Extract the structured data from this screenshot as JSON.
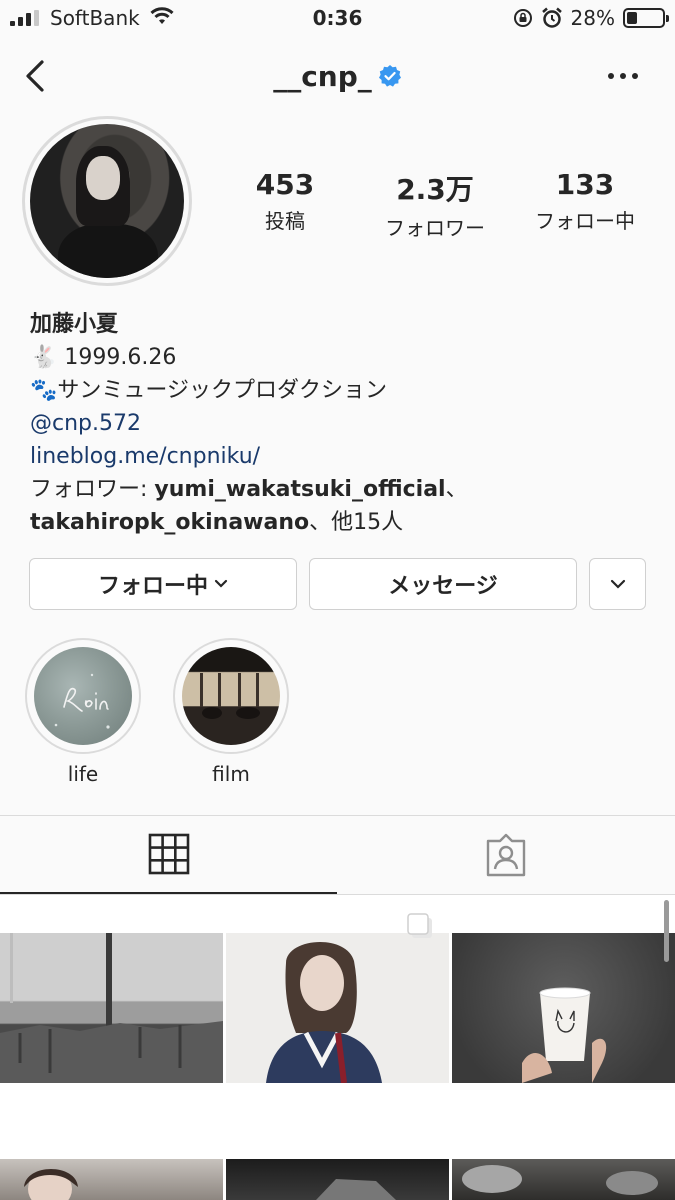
{
  "status_bar": {
    "carrier": "SoftBank",
    "time": "0:36",
    "battery": "28%",
    "battery_level": 0.28,
    "icons": [
      "signal-icon",
      "wifi-icon",
      "orientation-lock-icon",
      "alarm-icon",
      "battery-icon"
    ]
  },
  "header": {
    "username": "__cnp_",
    "verified": true,
    "icons": [
      "back-chevron-icon",
      "verified-badge-icon",
      "more-dots-icon"
    ]
  },
  "stats": [
    {
      "value": "453",
      "label": "投稿"
    },
    {
      "value": "2.3万",
      "label": "フォロワー"
    },
    {
      "value": "133",
      "label": "フォロー中"
    }
  ],
  "bio": {
    "name": "加藤小夏",
    "line1_emoji": "🐇",
    "line1": " 1999.6.26",
    "line2_emoji": "🐾",
    "line2": "サンミュージックプロダクション",
    "mention": "@cnp.572",
    "url": "lineblog.me/cnpniku/",
    "followers_prefix": "フォロワー: ",
    "followers_names1": "yumi_wakatsuki_official",
    "followers_sep": "、",
    "followers_names2": "takahiropk_okinawano",
    "followers_suffix": "、他15人"
  },
  "buttons": {
    "following": "フォロー中",
    "message": "メッセージ"
  },
  "highlights": [
    {
      "label": "life"
    },
    {
      "label": "film"
    }
  ],
  "tabs": [
    "grid-icon",
    "tagged-icon"
  ],
  "colors": {
    "background": "#fafafa",
    "text": "#262626",
    "link": "#1a3a6b",
    "verified": "#3897f0",
    "border": "#dbdbdb"
  }
}
